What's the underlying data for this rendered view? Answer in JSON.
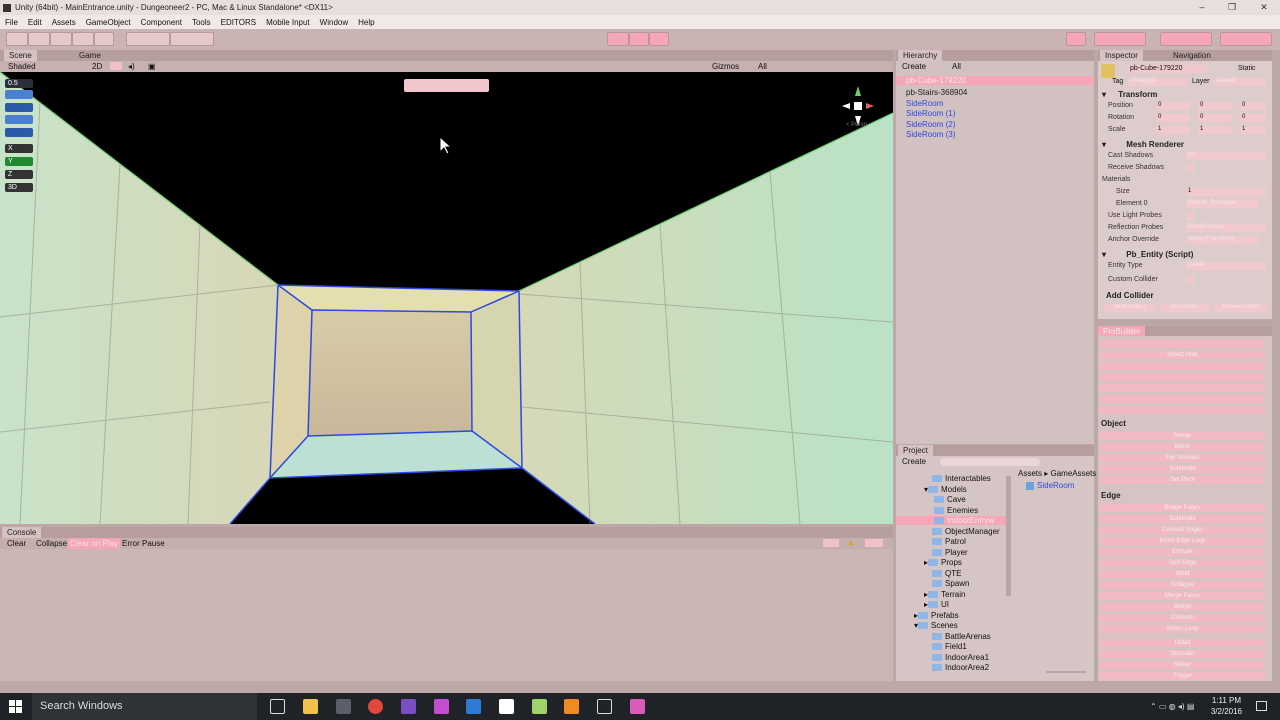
{
  "window": {
    "title": "Unity (64bit) - MainEntrance.unity - Dungeoneer2 - PC, Mac & Linux Standalone* <DX11>"
  },
  "menu": [
    "File",
    "Edit",
    "Assets",
    "GameObject",
    "Component",
    "Tools",
    "EDITORS",
    "Mobile Input",
    "Window",
    "Help"
  ],
  "scene": {
    "tabs": [
      "Scene",
      "Game"
    ],
    "shading": "Shaded",
    "mode2d": "2D",
    "gizmos": "Gizmos",
    "search": "All",
    "persp_label": "< Persp",
    "gizmo_buttons": [
      "0.5",
      "",
      "",
      "",
      "",
      "X",
      "Y",
      "Z",
      "3D"
    ]
  },
  "hierarchy": {
    "tab": "Hierarchy",
    "create": "Create",
    "search": "All",
    "items": [
      {
        "label": "pb-Cube-179220",
        "style": "selected"
      },
      {
        "label": "pb-Stairs-368904",
        "style": "normal"
      },
      {
        "label": "SideRoom",
        "style": "blue"
      },
      {
        "label": "SideRoom (1)",
        "style": "blue"
      },
      {
        "label": "SideRoom (2)",
        "style": "blue"
      },
      {
        "label": "SideRoom (3)",
        "style": "blue"
      }
    ]
  },
  "inspector": {
    "tabs": [
      "Inspector",
      "Navigation"
    ],
    "object_name": "pb-Cube-179220",
    "static": "Static",
    "tag": "Tag",
    "tag_value": "Untagged",
    "layer": "Layer",
    "layer_value": "Default",
    "transform": {
      "title": "Transform",
      "rows": [
        {
          "label": "Position",
          "x": "0",
          "y": "0",
          "z": "0"
        },
        {
          "label": "Rotation",
          "x": "0",
          "y": "0",
          "z": "0"
        },
        {
          "label": "Scale",
          "x": "1",
          "y": "1",
          "z": "1"
        }
      ]
    },
    "mesh_renderer": {
      "title": "Mesh Renderer",
      "rows": [
        "Cast Shadows",
        "Receive Shadows",
        "Materials",
        "Size",
        "Element 0",
        "Use Light Probes",
        "Reflection Probes",
        "Anchor Override"
      ],
      "cast_shadows_value": "On",
      "size_value": "1",
      "element0_value": "Default_Prototype",
      "reflection_probes_value": "Blend Probes",
      "anchor_override_value": "None (Transform)"
    },
    "pb_entity": {
      "title": "Pb_Entity (Script)",
      "rows": [
        "Entity Type",
        "Custom Collider"
      ],
      "entity_type_value": "Detail"
    },
    "add_collider": "Add Collider",
    "collider_buttons": [
      "Mesh Collider",
      "Box Collider",
      "Remove Collider"
    ]
  },
  "probuilder": {
    "tab": "ProBuilder",
    "top_buttons": [
      "",
      "Select Hole",
      "",
      "",
      "",
      "",
      "",
      ""
    ],
    "object_title": "Object",
    "object_buttons": [
      "Merge",
      "Mirror",
      "Flip Normals",
      "Subdivide",
      "Set Pivot"
    ],
    "edge_title": "Edge",
    "edge_buttons": [
      "Bridge Edges",
      "Subdivide",
      "Connect Edges",
      "Insert Edge Loop",
      "Extrude",
      "Split Edge",
      "Weld",
      "Collapse",
      "Merge Faces",
      "Bridge",
      "Conform",
      "Select Loop"
    ],
    "bottom_buttons": [
      "Detail",
      "Occluder",
      "Mover",
      "Trigger"
    ]
  },
  "console": {
    "tab": "Console",
    "buttons": [
      "Clear",
      "Collapse",
      "Clear on Play",
      "Error Pause"
    ]
  },
  "project": {
    "tab": "Project",
    "create": "Create",
    "breadcrumb": [
      "Assets",
      "GameAssets"
    ],
    "tree": [
      {
        "label": "Interactables",
        "indent": 2
      },
      {
        "label": "Models",
        "indent": 1,
        "open": true
      },
      {
        "label": "Cave",
        "indent": 2
      },
      {
        "label": "Enemies",
        "indent": 2
      },
      {
        "label": "IndoorEntryw",
        "indent": 2,
        "selected": true
      },
      {
        "label": "ObjectManager",
        "indent": 1
      },
      {
        "label": "Patrol",
        "indent": 1
      },
      {
        "label": "Player",
        "indent": 1
      },
      {
        "label": "Props",
        "indent": 1
      },
      {
        "label": "QTE",
        "indent": 1
      },
      {
        "label": "Spawn",
        "indent": 1
      },
      {
        "label": "Terrain",
        "indent": 1
      },
      {
        "label": "UI",
        "indent": 1
      },
      {
        "label": "Prefabs",
        "indent": 0
      },
      {
        "label": "Scenes",
        "indent": 0,
        "open": true
      },
      {
        "label": "BattleArenas",
        "indent": 1
      },
      {
        "label": "Field1",
        "indent": 1
      },
      {
        "label": "IndoorArea1",
        "indent": 1
      },
      {
        "label": "IndoorArea2",
        "indent": 1
      }
    ],
    "assets": [
      "SideRoom"
    ]
  },
  "taskbar": {
    "search": "Search Windows",
    "time": "1:11 PM",
    "date": "3/2/2016"
  },
  "colors": {
    "selection_blue": "#2c49e0",
    "play_pink": "#f5a6b7",
    "panel_bg": "#d2c1c1"
  }
}
